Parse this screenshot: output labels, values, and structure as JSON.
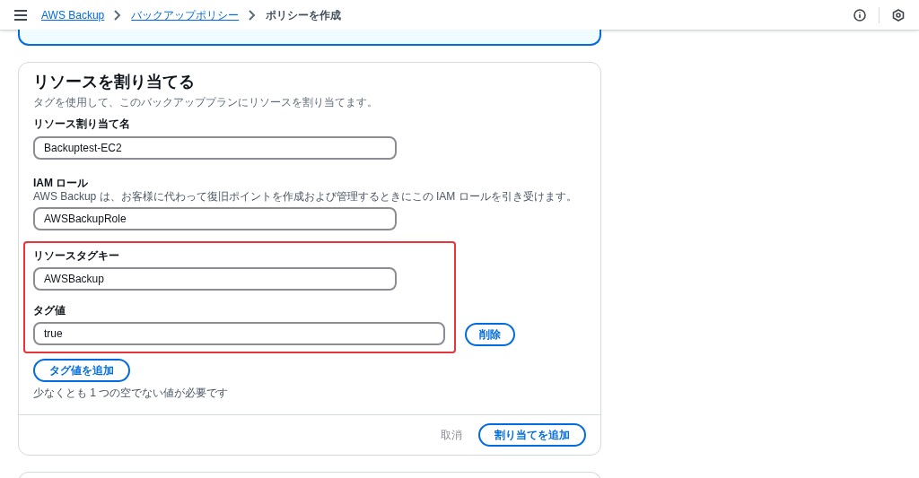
{
  "breadcrumbs": [
    {
      "label": "AWS Backup",
      "link": true
    },
    {
      "label": "バックアップポリシー",
      "link": true
    },
    {
      "label": "ポリシーを作成",
      "link": false
    }
  ],
  "card": {
    "title": "リソースを割り当てる",
    "description": "タグを使用して、このバックアッププランにリソースを割り当てます。",
    "assignment_name": {
      "label": "リソース割り当て名",
      "value": "Backuptest-EC2"
    },
    "iam_role": {
      "label": "IAM ロール",
      "hint": "AWS Backup は、お客様に代わって復旧ポイントを作成および管理するときにこの IAM ロールを引き受けます。",
      "value": "AWSBackupRole"
    },
    "tag_key": {
      "label": "リソースタグキー",
      "value": "AWSBackup"
    },
    "tag_value": {
      "label": "タグ値",
      "value": "true",
      "remove_button": "削除"
    },
    "add_tag_value_button": "タグ値を追加",
    "requirement_note": "少なくとも 1 つの空でない値が必要です",
    "cancel_button": "取消",
    "submit_button": "割り当てを追加"
  }
}
